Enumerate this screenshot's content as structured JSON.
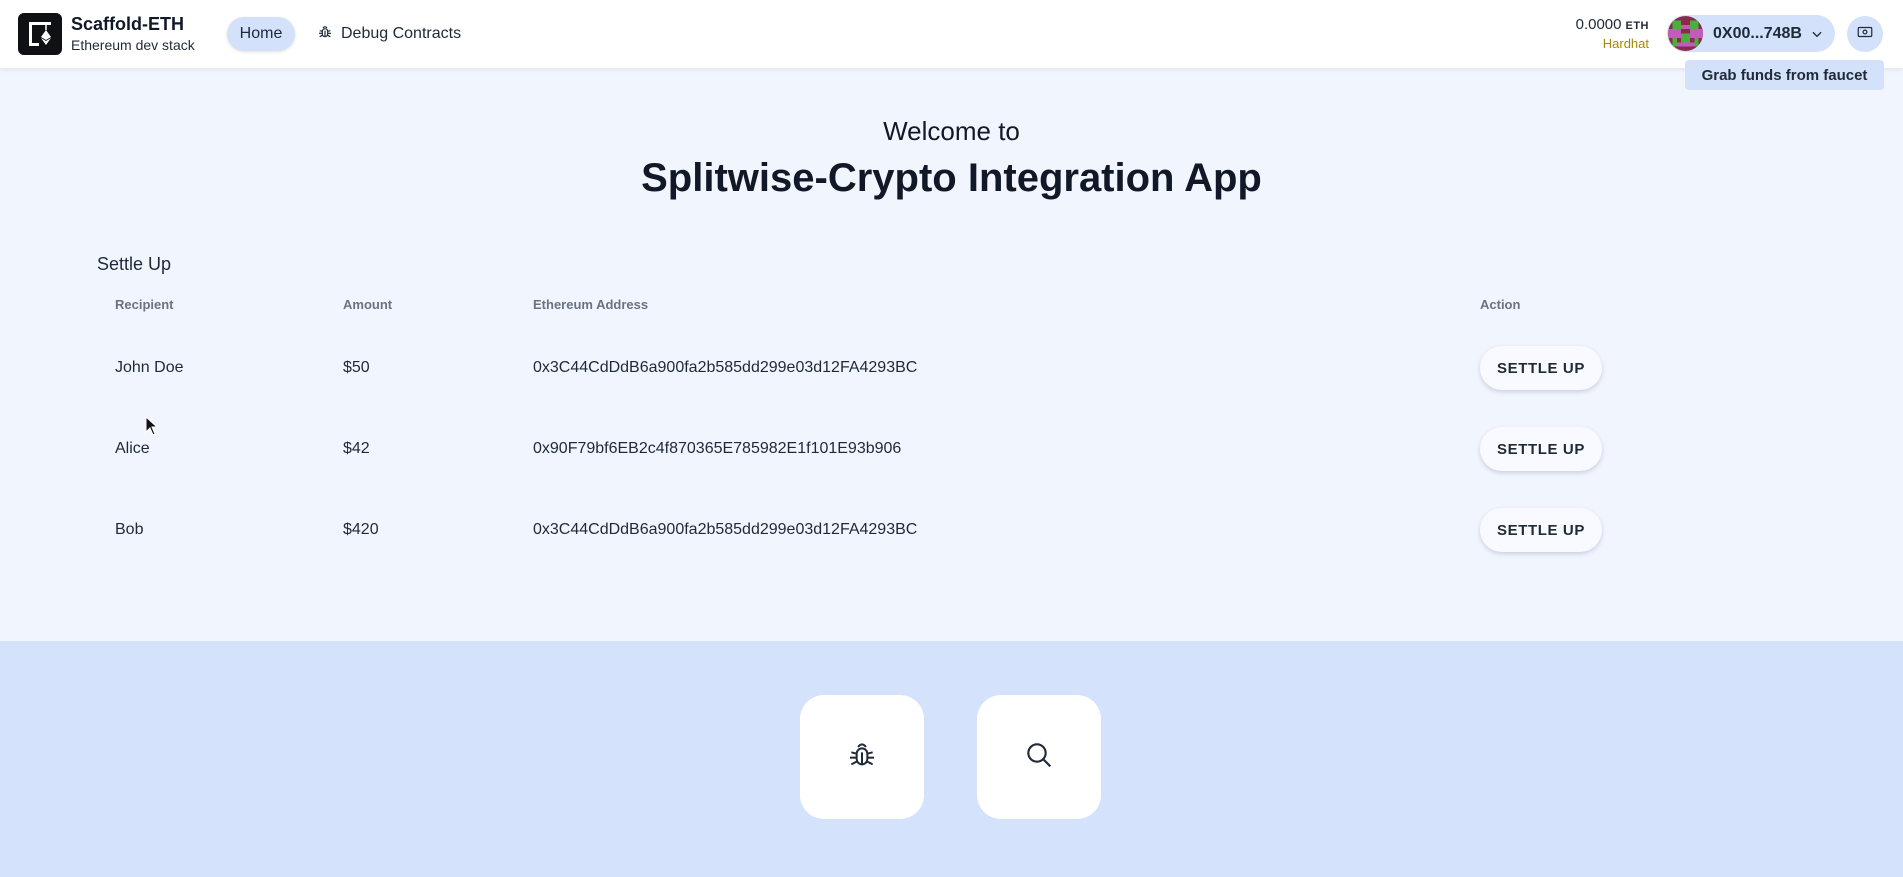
{
  "header": {
    "brand_title": "Scaffold-ETH",
    "brand_subtitle": "Ethereum dev stack",
    "nav": [
      {
        "label": "Home",
        "active": true
      },
      {
        "label": "Debug Contracts",
        "icon": "bug-icon"
      }
    ],
    "balance": {
      "amount": "0.0000",
      "unit": "ETH"
    },
    "network": "Hardhat",
    "account": "0X00...748B",
    "faucet_tooltip": "Grab funds from faucet"
  },
  "hero": {
    "welcome": "Welcome to",
    "title": "Splitwise-Crypto Integration App"
  },
  "settle": {
    "title": "Settle Up",
    "columns": [
      "Recipient",
      "Amount",
      "Ethereum Address",
      "Action"
    ],
    "rows": [
      {
        "recipient": "John Doe",
        "amount": "$50",
        "address": "0x3C44CdDdB6a900fa2b585dd299e03d12FA4293BC",
        "action": "SETTLE UP"
      },
      {
        "recipient": "Alice",
        "amount": "$42",
        "address": "0x90F79bf6EB2c4f870365E785982E1f101E93b906",
        "action": "SETTLE UP"
      },
      {
        "recipient": "Bob",
        "amount": "$420",
        "address": "0x3C44CdDdB6a900fa2b585dd299e03d12FA4293BC",
        "action": "SETTLE UP"
      }
    ]
  },
  "footer_tiles": [
    {
      "icon": "bug-icon"
    },
    {
      "icon": "search-icon"
    }
  ],
  "colors": {
    "background": "#f1f5fe",
    "accent": "#d3e1fb",
    "band": "#d4e2fb",
    "network": "#a58b00"
  }
}
